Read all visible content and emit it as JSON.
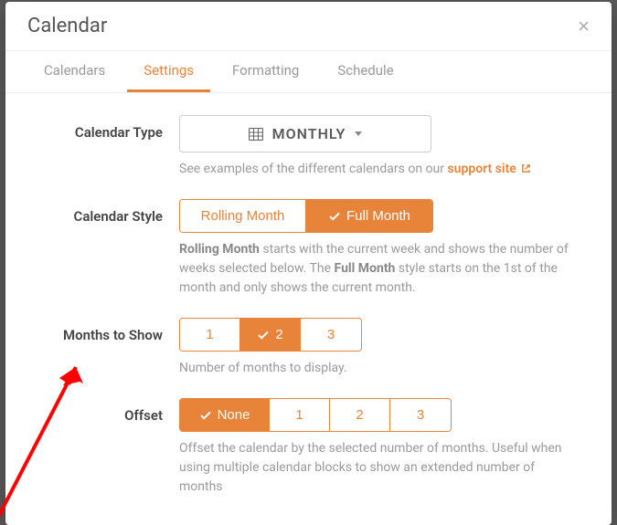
{
  "dialog": {
    "title": "Calendar"
  },
  "tabs": {
    "calendars": "Calendars",
    "settings": "Settings",
    "formatting": "Formatting",
    "schedule": "Schedule"
  },
  "fields": {
    "type": {
      "label": "Calendar Type",
      "value": "MONTHLY",
      "help_pre": "See examples of the different calendars on our ",
      "link": "support site"
    },
    "style": {
      "label": "Calendar Style",
      "opt_rolling": "Rolling Month",
      "opt_full": "Full Month",
      "help_a": "Rolling Month",
      "help_b": " starts with the current week and shows the number of weeks selected below. The ",
      "help_c": "Full Month",
      "help_d": " style starts on the 1st of the month and only shows the current month."
    },
    "months": {
      "label": "Months to Show",
      "opt1": "1",
      "opt2": "2",
      "opt3": "3",
      "help": "Number of months to display."
    },
    "offset": {
      "label": "Offset",
      "opt_none": "None",
      "opt1": "1",
      "opt2": "2",
      "opt3": "3",
      "help": "Offset the calendar by the selected number of months. Useful when using multiple calendar blocks to show an extended number of months"
    }
  }
}
